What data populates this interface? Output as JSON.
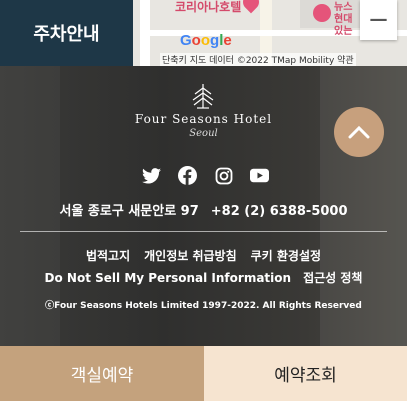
{
  "map": {
    "hotel_label": "코리아나호텔",
    "poi_label": "뉴스 현대 있는",
    "google_logo": [
      "G",
      "o",
      "o",
      "g",
      "l",
      "e"
    ],
    "attribution": "단축키  지도 데이터 ©2022 TMap Mobility  약관",
    "zoom_out": "−"
  },
  "parking_tab": "주차안내",
  "footer": {
    "brand_name": "Four Seasons Hotel",
    "brand_city": "Seoul",
    "social_icons": [
      "twitter-icon",
      "facebook-icon",
      "instagram-icon",
      "youtube-icon"
    ],
    "address": "서울 종로구 새문안로 97",
    "phone": "+82 (2) 6388-5000",
    "links_row1": [
      "법적고지",
      "개인정보 취급방침",
      "쿠키 환경설정"
    ],
    "links_row2": [
      "Do Not Sell My Personal Information",
      "접근성 정책"
    ],
    "copyright": "ⓒFour Seasons Hotels Limited 1997-2022. All Rights Reserved"
  },
  "actions": {
    "book_room": "객실예약",
    "lookup_reservation": "예약조회"
  },
  "colors": {
    "parking_tab_bg": "#1e3747",
    "book_bg": "#c4a27d",
    "lookup_bg": "#f6e4d0",
    "scroll_top_bg": "#c7a07d"
  }
}
